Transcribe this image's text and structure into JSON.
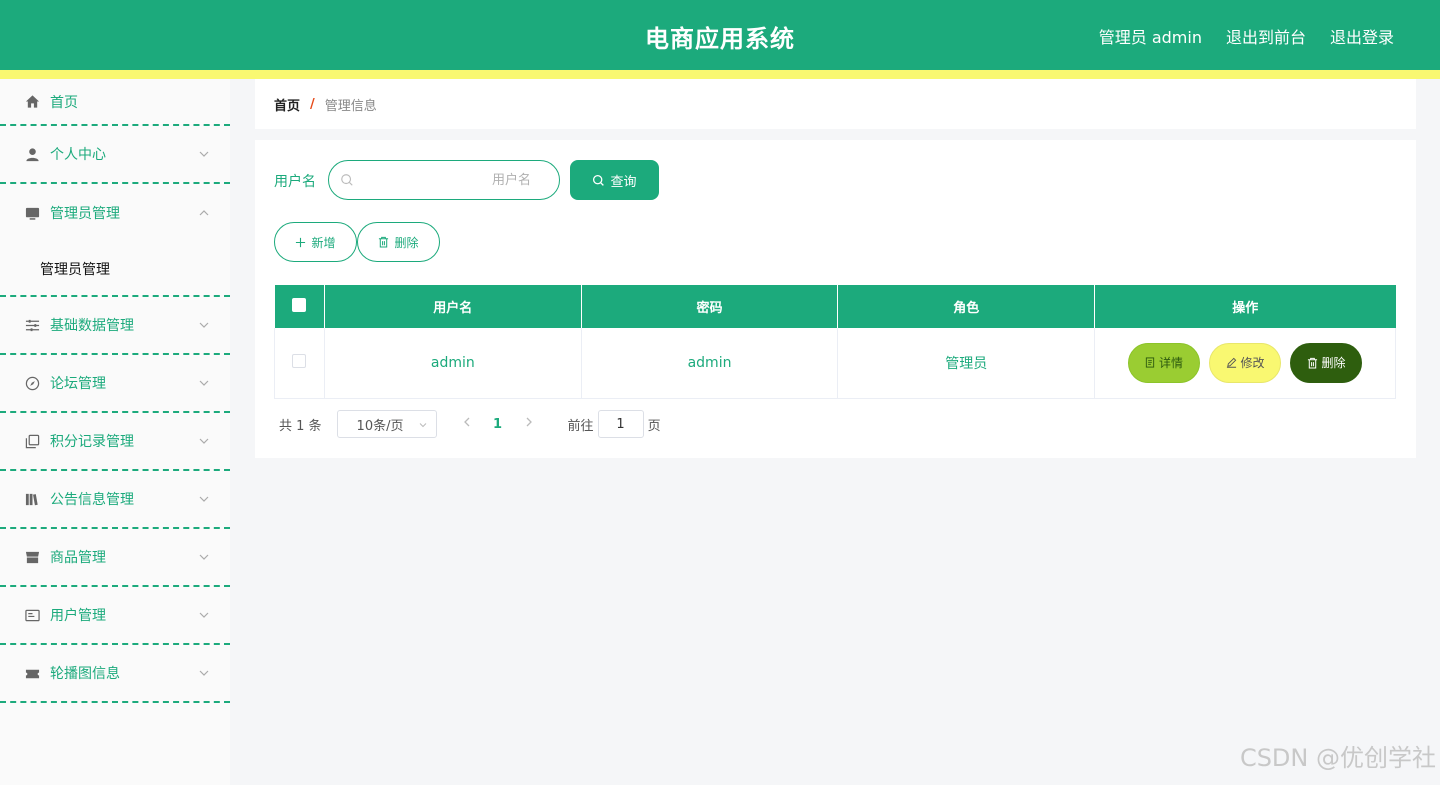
{
  "header": {
    "title": "电商应用系统",
    "user_label": "管理员 admin",
    "front_link": "退出到前台",
    "logout_link": "退出登录"
  },
  "colors": {
    "primary": "#1caa7c",
    "stripe": "#f9f871",
    "detail": "#9acd32",
    "edit": "#f9f871",
    "delete": "#2e5e0e"
  },
  "sidebar": {
    "items": [
      {
        "label": "首页",
        "icon": "home-icon"
      },
      {
        "label": "个人中心",
        "icon": "user-icon"
      },
      {
        "label": "管理员管理",
        "icon": "monitor-icon",
        "submenu": "管理员管理"
      },
      {
        "label": "基础数据管理",
        "icon": "sliders-icon"
      },
      {
        "label": "论坛管理",
        "icon": "compass-icon"
      },
      {
        "label": "积分记录管理",
        "icon": "copy-icon"
      },
      {
        "label": "公告信息管理",
        "icon": "books-icon"
      },
      {
        "label": "商品管理",
        "icon": "shop-icon"
      },
      {
        "label": "用户管理",
        "icon": "idcard-icon"
      },
      {
        "label": "轮播图信息",
        "icon": "ticket-icon"
      }
    ]
  },
  "breadcrumb": {
    "home": "首页",
    "separator": "/",
    "current": "管理信息"
  },
  "search": {
    "label": "用户名",
    "placeholder": "用户名",
    "value": "",
    "button": "查询"
  },
  "actions": {
    "add": "新增",
    "delete": "删除"
  },
  "table": {
    "headers": [
      "用户名",
      "密码",
      "角色",
      "操作"
    ],
    "rows": [
      {
        "username": "admin",
        "password": "admin",
        "role": "管理员"
      }
    ],
    "row_actions": {
      "detail": "详情",
      "edit": "修改",
      "delete": "删除"
    }
  },
  "pagination": {
    "total": "共 1 条",
    "page_size": "10条/页",
    "current_page": "1",
    "goto_label": "前往",
    "goto_value": "1",
    "goto_suffix": "页"
  },
  "watermark": "CSDN @优创学社"
}
